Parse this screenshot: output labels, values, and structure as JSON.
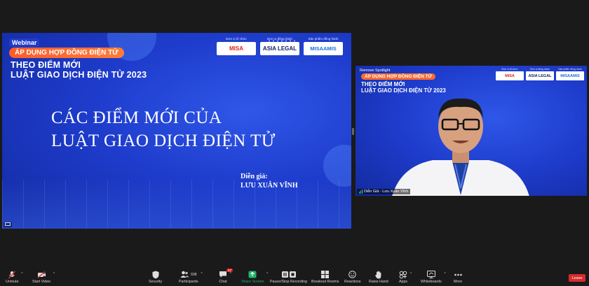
{
  "slide": {
    "webinar_tag": "Webinar",
    "pill": "ÁP DỤNG HỢP ĐỒNG ĐIỆN TỬ",
    "headline_1": "THEO ĐIỂM MỚI",
    "headline_2": "LUẬT GIAO DỊCH ĐIỆN TỬ 2023",
    "sponsors": [
      {
        "caption": "Đơn vị tổ chức",
        "logo": "MISA"
      },
      {
        "caption": "Đơn vị đồng hành",
        "logo": "ASIA LEGAL"
      },
      {
        "caption": "Sản phẩm đồng hành",
        "logo": "MISAAMIS"
      }
    ],
    "title_line_1": "CÁC ĐIỂM MỚI CỦA",
    "title_line_2": "LUẬT GIAO DỊCH ĐIỆN TỬ",
    "speaker_label": "Diễn giả:",
    "speaker_name": "LƯU XUÂN VĨNH"
  },
  "video": {
    "spotlight": "Remove Spotlight",
    "pill": "ÁP DỤNG HỢP ĐỒNG ĐIỆN TỬ",
    "headline_1": "THEO ĐIỂM MỚI",
    "headline_2": "LUẬT GIAO DỊCH ĐIỆN TỬ 2023",
    "participant_name": "Diễn Giả - Lưu Xuân Vĩnh",
    "sponsors": [
      {
        "caption": "Đơn vị tổ chức",
        "logo": "MISA"
      },
      {
        "caption": "Đơn vị đồng hành",
        "logo": "ASIA LEGAL"
      },
      {
        "caption": "Sản phẩm đồng hành",
        "logo": "MISAAMIS"
      }
    ]
  },
  "toolbar": {
    "unmute": "Unmute",
    "start_video": "Start Video",
    "security": "Security",
    "participants": "Participants",
    "participants_count": "698",
    "chat": "Chat",
    "chat_badge": "27",
    "share_screen": "Share Screen",
    "recording": "Pause/Stop Recording",
    "breakout": "Breakout Rooms",
    "reactions": "Reactions",
    "raise_hand": "Raise Hand",
    "apps": "Apps",
    "whiteboards": "Whiteboards",
    "more": "More",
    "leave": "Leave"
  },
  "colors": {
    "slide_blue": "#1e3ccc",
    "accent_orange": "#ff6a30",
    "leave_red": "#d62b2b",
    "share_green": "#23b26b"
  }
}
